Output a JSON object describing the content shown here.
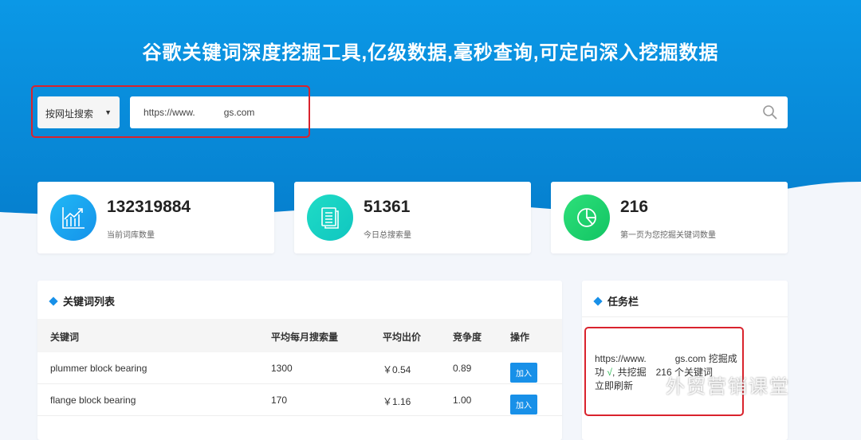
{
  "header": {
    "title": "谷歌关键词深度挖掘工具,亿级数据,毫秒查询,可定向深入挖掘数据"
  },
  "search": {
    "mode": "按网址搜索",
    "value": "https://www.   gs.com"
  },
  "stats": [
    {
      "value": "132319884",
      "label": "当前词库数量",
      "icon": "chart-growth-icon"
    },
    {
      "value": "51361",
      "label": "今日总搜索量",
      "icon": "document-icon"
    },
    {
      "value": "216",
      "label": "第一页为您挖掘关键词数量",
      "icon": "pie-chart-icon"
    }
  ],
  "keywords": {
    "title": "关键词列表",
    "columns": [
      "关键词",
      "平均每月搜索量",
      "平均出价",
      "竞争度",
      "操作"
    ],
    "rows": [
      {
        "keyword": "plummer block bearing",
        "volume": "1300",
        "bid": "￥0.54",
        "competition": "0.89",
        "action": "加入"
      },
      {
        "keyword": "flange block bearing",
        "volume": "170",
        "bid": "￥1.16",
        "competition": "1.00",
        "action": "加入"
      }
    ]
  },
  "tasks": {
    "title": "任务栏",
    "line1": "https://www.   gs.com 挖掘成功",
    "check": "√",
    "line2": ", 共挖掘 216 个关键词",
    "refresh": "立即刷新"
  },
  "watermark": "外贸营销课堂",
  "colors": {
    "primary": "#1890e8",
    "highlight": "#d9232d"
  }
}
